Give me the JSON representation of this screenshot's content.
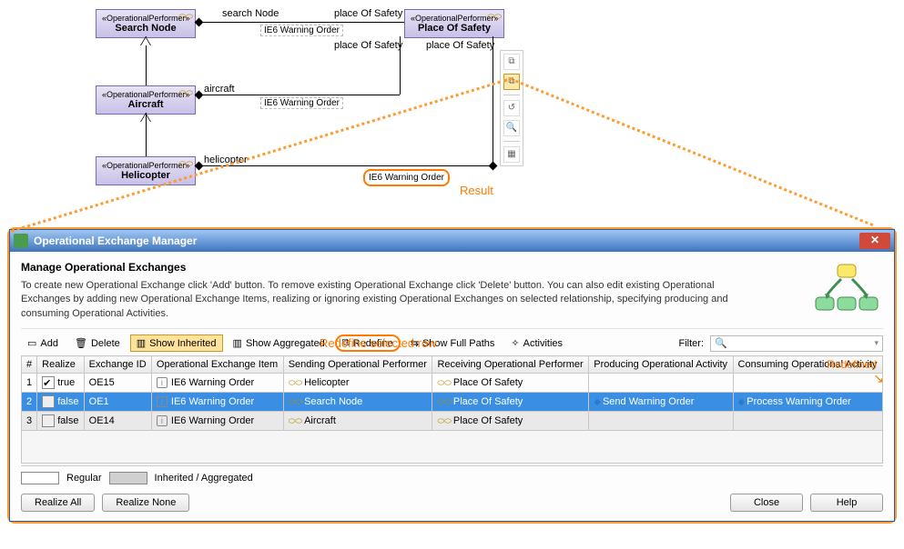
{
  "diagram": {
    "nodes": {
      "search": {
        "stereo": "«OperationalPerformer»",
        "name": "Search Node"
      },
      "aircraft": {
        "stereo": "«OperationalPerformer»",
        "name": "Aircraft"
      },
      "helicopter": {
        "stereo": "«OperationalPerformer»",
        "name": "Helicopter"
      },
      "safety": {
        "stereo": "«OperationalPerformer»",
        "name": "Place Of Safety"
      }
    },
    "labels": {
      "searchNodeEdge": "search Node",
      "placeOfSafety": "place Of Safety",
      "aircraftEdge": "aircraft",
      "helicopterEdge": "helicopter",
      "ie6warning": "IE6 Warning Order"
    },
    "resultLabel": "Result"
  },
  "dialog": {
    "title": "Operational Exchange Manager",
    "heading": "Manage Operational Exchanges",
    "description": "To create new Operational Exchange click 'Add' button. To remove existing Operational Exchange click 'Delete' button. You can also edit existing Operational Exchanges by adding new Operational Exchange Items, realizing or ignoring existing Operational Exchanges on selected relationship, specifying producing and consuming Operational Activities.",
    "annotations": {
      "redefineRow": "Redefine selected row",
      "redefined": "Redefined"
    },
    "toolbar": {
      "add": "Add",
      "delete": "Delete",
      "showInherited": "Show Inherited",
      "showAggregated": "Show Aggregated",
      "redefine": "Redefine",
      "showFullPaths": "Show Full Paths",
      "activities": "Activities",
      "filterLabel": "Filter:"
    },
    "columns": {
      "num": "#",
      "realize": "Realize",
      "exchangeId": "Exchange ID",
      "item": "Operational Exchange Item",
      "sending": "Sending Operational Performer",
      "receiving": "Receiving Operational Performer",
      "producing": "Producing Operational Activity",
      "consuming": "Consuming Operational Activity"
    },
    "rows": [
      {
        "num": "1",
        "realize": "checked",
        "id": "OE15",
        "item": "IE6 Warning Order",
        "send": "Helicopter",
        "recv": "Place Of Safety",
        "prod": "",
        "cons": ""
      },
      {
        "num": "2",
        "realize": "empty",
        "id": "OE1",
        "item": "IE6 Warning Order",
        "send": "Search Node",
        "recv": "Place Of Safety",
        "prod": "Send Warning Order",
        "cons": "Process Warning Order"
      },
      {
        "num": "3",
        "realize": "empty",
        "id": "OE14",
        "item": "IE6 Warning Order",
        "send": "Aircraft",
        "recv": "Place Of Safety",
        "prod": "",
        "cons": ""
      }
    ],
    "trueLabel": "true",
    "falseLabel": "false",
    "legend": {
      "regular": "Regular",
      "inherited": "Inherited / Aggregated"
    },
    "buttons": {
      "realizeAll": "Realize All",
      "realizeNone": "Realize None",
      "close": "Close",
      "help": "Help"
    }
  }
}
